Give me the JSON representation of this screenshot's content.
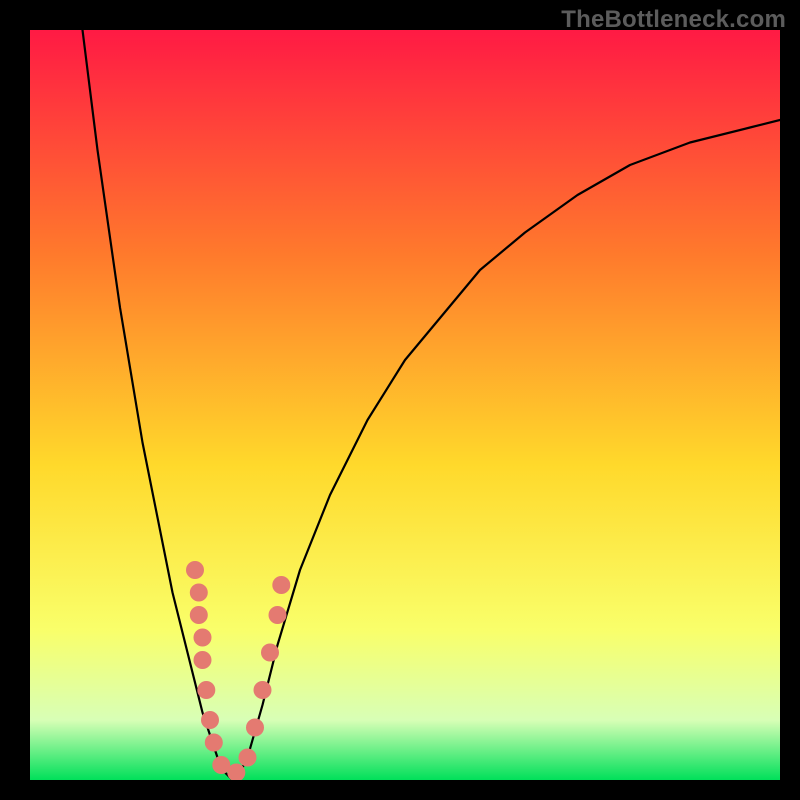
{
  "watermark": "TheBottleneck.com",
  "colors": {
    "gradient_top": "#ff1a44",
    "gradient_upper_mid": "#ff7a2c",
    "gradient_mid": "#ffd92b",
    "gradient_lower_mid": "#f9ff6a",
    "gradient_low": "#d8ffb6",
    "gradient_bottom": "#00e05a",
    "curve": "#000000",
    "marker": "#e47a71",
    "frame": "#000000"
  },
  "chart_data": {
    "type": "line",
    "title": "",
    "xlabel": "",
    "ylabel": "",
    "xlim": [
      0,
      100
    ],
    "ylim": [
      0,
      100
    ],
    "series": [
      {
        "name": "curve",
        "x": [
          7,
          8,
          9,
          10,
          11,
          12,
          13,
          14,
          15,
          16,
          17,
          18,
          19,
          20,
          21,
          22,
          23,
          24,
          25,
          26,
          27,
          28,
          29,
          31,
          33,
          36,
          40,
          45,
          50,
          55,
          60,
          66,
          73,
          80,
          88,
          96,
          100
        ],
        "y": [
          100,
          92,
          84,
          77,
          70,
          63,
          57,
          51,
          45,
          40,
          35,
          30,
          25,
          21,
          17,
          13,
          9,
          6,
          3,
          1,
          0,
          1,
          3,
          10,
          18,
          28,
          38,
          48,
          56,
          62,
          68,
          73,
          78,
          82,
          85,
          87,
          88
        ]
      }
    ],
    "markers": [
      {
        "x": 22,
        "y": 28
      },
      {
        "x": 22.5,
        "y": 25
      },
      {
        "x": 22.5,
        "y": 22
      },
      {
        "x": 23,
        "y": 19
      },
      {
        "x": 23,
        "y": 16
      },
      {
        "x": 23.5,
        "y": 12
      },
      {
        "x": 24,
        "y": 8
      },
      {
        "x": 24.5,
        "y": 5
      },
      {
        "x": 25.5,
        "y": 2
      },
      {
        "x": 27.5,
        "y": 1
      },
      {
        "x": 29,
        "y": 3
      },
      {
        "x": 30,
        "y": 7
      },
      {
        "x": 31,
        "y": 12
      },
      {
        "x": 32,
        "y": 17
      },
      {
        "x": 33,
        "y": 22
      },
      {
        "x": 33.5,
        "y": 26
      }
    ]
  }
}
